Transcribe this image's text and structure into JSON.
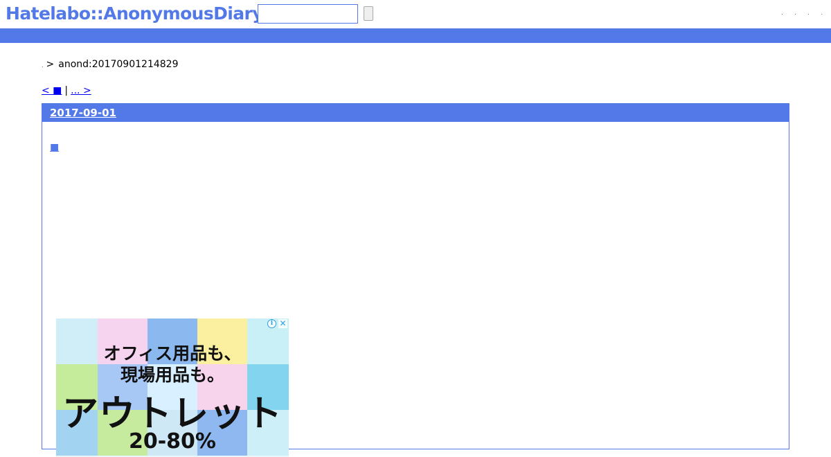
{
  "header": {
    "logo": "Hatelabo::AnonymousDiary",
    "search": {
      "value": "",
      "button_label": ""
    },
    "links": [
      ".",
      ".",
      ".",
      "."
    ]
  },
  "breadcrumb": {
    "home": ".",
    "separator": ">",
    "current": "anond:20170901214829"
  },
  "pager": {
    "prev": "< ■",
    "divider": "|",
    "next": "... > "
  },
  "day": {
    "date": "2017-09-01",
    "entry_anchor": "■"
  },
  "ad": {
    "lines": [
      "オフィス用品も、",
      "現場用品も。",
      "アウトレット",
      "20-80%"
    ],
    "info_icon": "info-icon",
    "close_icon": "close-icon"
  },
  "colors": {
    "accent": "#5279e7",
    "link": "#0000ee",
    "ad_info": "#2ba0dd"
  }
}
